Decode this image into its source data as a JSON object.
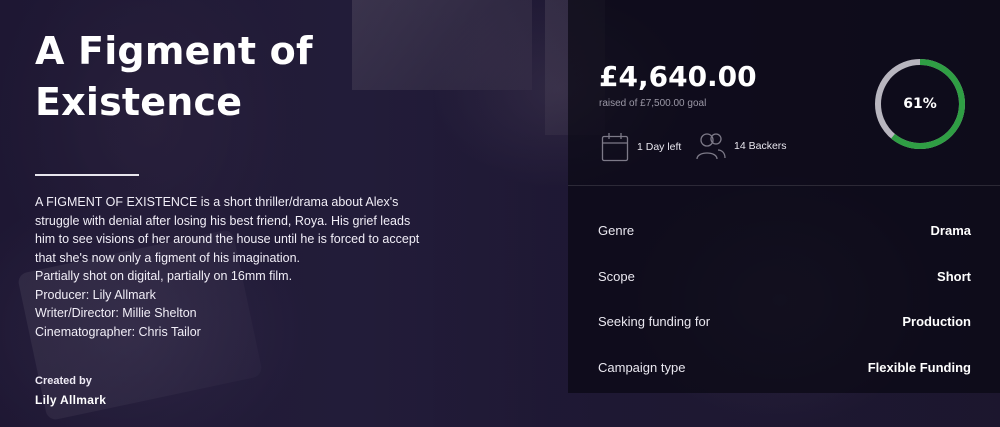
{
  "campaign": {
    "title": "A Figment of Existence",
    "description_lines": [
      "A FIGMENT OF EXISTENCE is a short thriller/drama about Alex's",
      "struggle with denial after losing his best friend, Roya. His grief leads",
      "him to see visions of her around the house until he is forced to accept",
      "that she's now only a figment of his imagination.",
      "Partially shot on digital, partially on 16mm film.",
      "Producer: Lily Allmark",
      "Writer/Director: Millie Shelton",
      "Cinematographer: Chris Tailor"
    ],
    "created_by_label": "Created by",
    "creator": "Lily Allmark"
  },
  "funding": {
    "raised": "£4,640.00",
    "goal_text": "raised of £7,500.00 goal",
    "percent_label": "61%",
    "percent_value": 61,
    "days_left": "1 Day left",
    "backers": "14 Backers",
    "ring_color": "#2f9e44",
    "ring_track_color": "#b8b6bf"
  },
  "details": [
    {
      "label": "Genre",
      "value": "Drama"
    },
    {
      "label": "Scope",
      "value": "Short"
    },
    {
      "label": "Seeking funding for",
      "value": "Production"
    },
    {
      "label": "Campaign type",
      "value": "Flexible Funding"
    }
  ]
}
